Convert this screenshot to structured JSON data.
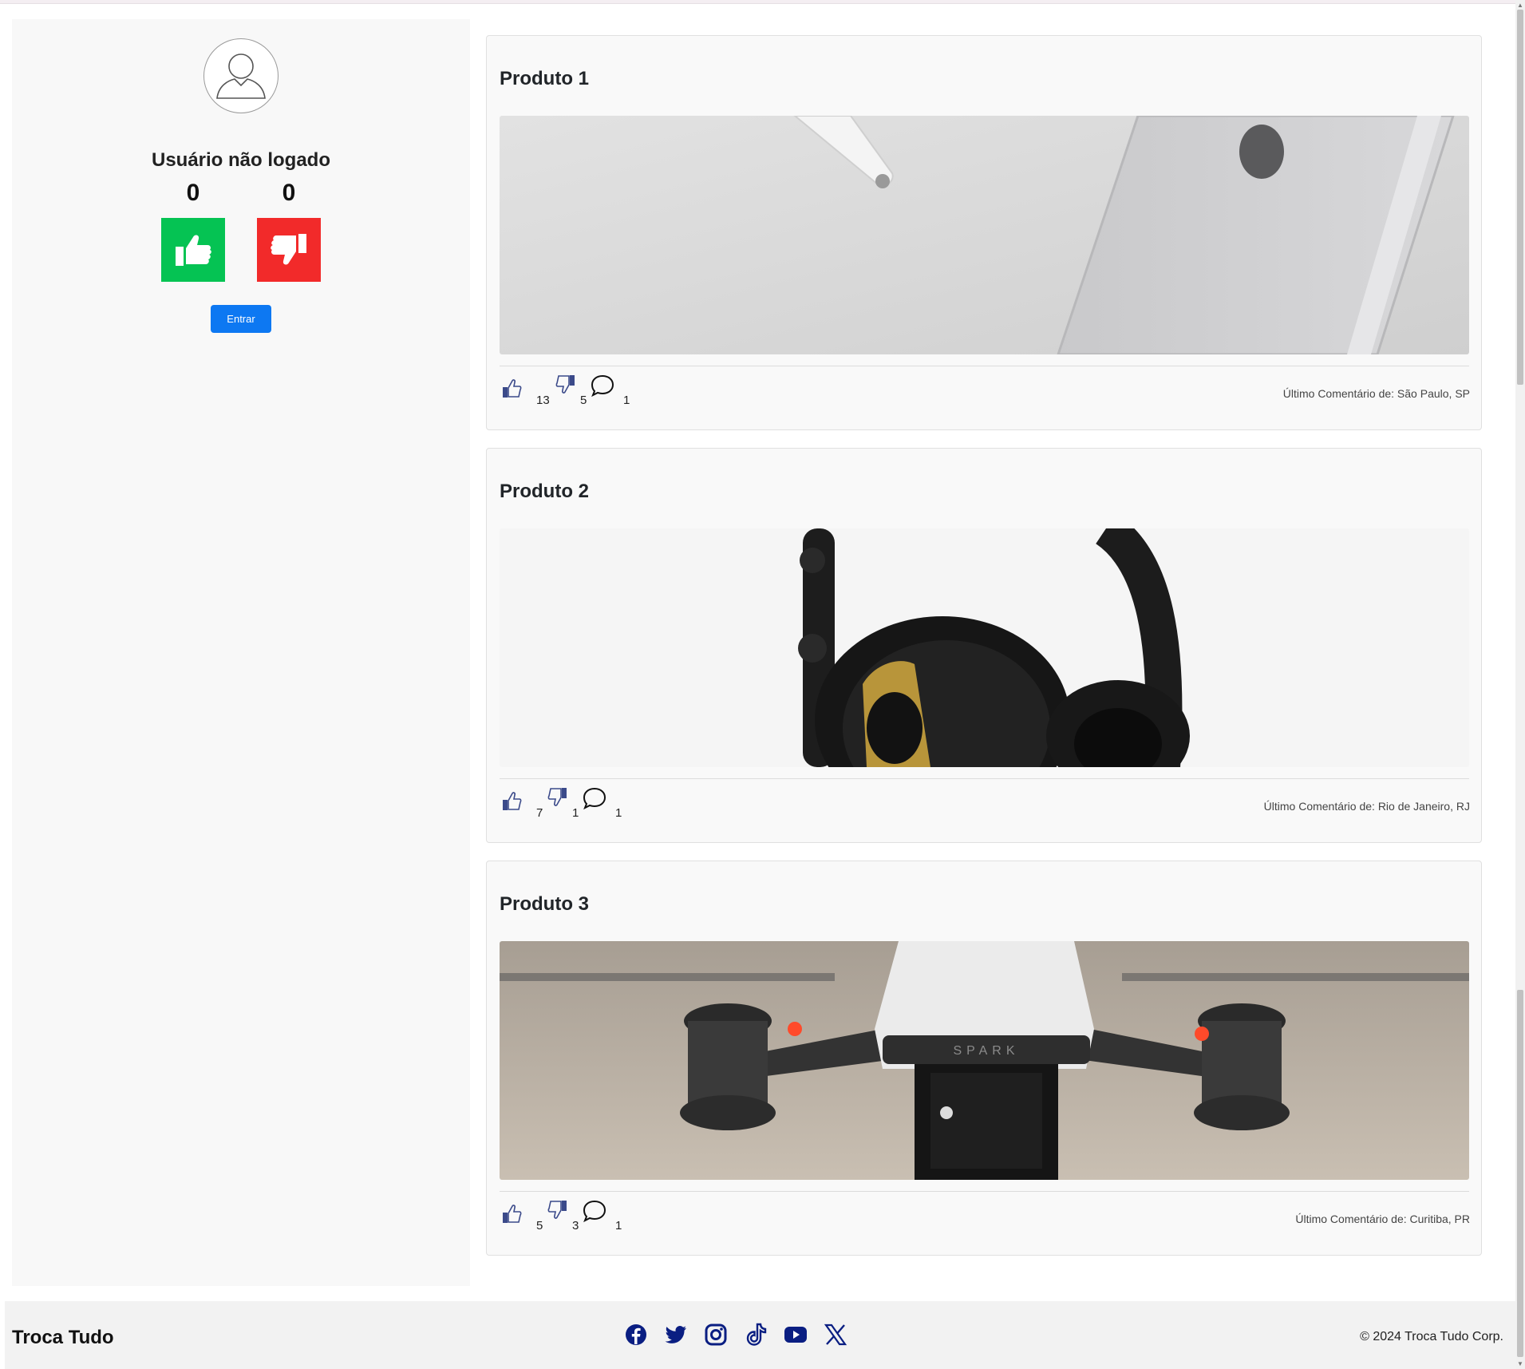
{
  "sidebar": {
    "user_status": "Usuário não logado",
    "likes_count": "0",
    "dislikes_count": "0",
    "login_label": "Entrar"
  },
  "products": [
    {
      "title": "Produto 1",
      "likes": "13",
      "dislikes": "5",
      "comments": "1",
      "last_comment": "Último Comentário de: São Paulo, SP",
      "image": "earbud-and-phone"
    },
    {
      "title": "Produto 2",
      "likes": "7",
      "dislikes": "1",
      "comments": "1",
      "last_comment": "Último Comentário de: Rio de Janeiro, RJ",
      "image": "headphones"
    },
    {
      "title": "Produto 3",
      "likes": "5",
      "dislikes": "3",
      "comments": "1",
      "last_comment": "Último Comentário de: Curitiba, PR",
      "image": "drone"
    }
  ],
  "drone_label": "SPARK",
  "footer": {
    "brand": "Troca Tudo",
    "copyright": "© 2024 Troca Tudo Corp.",
    "social_icons": [
      "facebook-icon",
      "twitter-icon",
      "instagram-icon",
      "tiktok-icon",
      "youtube-icon",
      "x-icon"
    ]
  },
  "colors": {
    "like": "#05c353",
    "dislike": "#f22a2a",
    "primary": "#0d78f2",
    "social": "#0a1e82",
    "stat_icon": "#3b4a8a"
  }
}
